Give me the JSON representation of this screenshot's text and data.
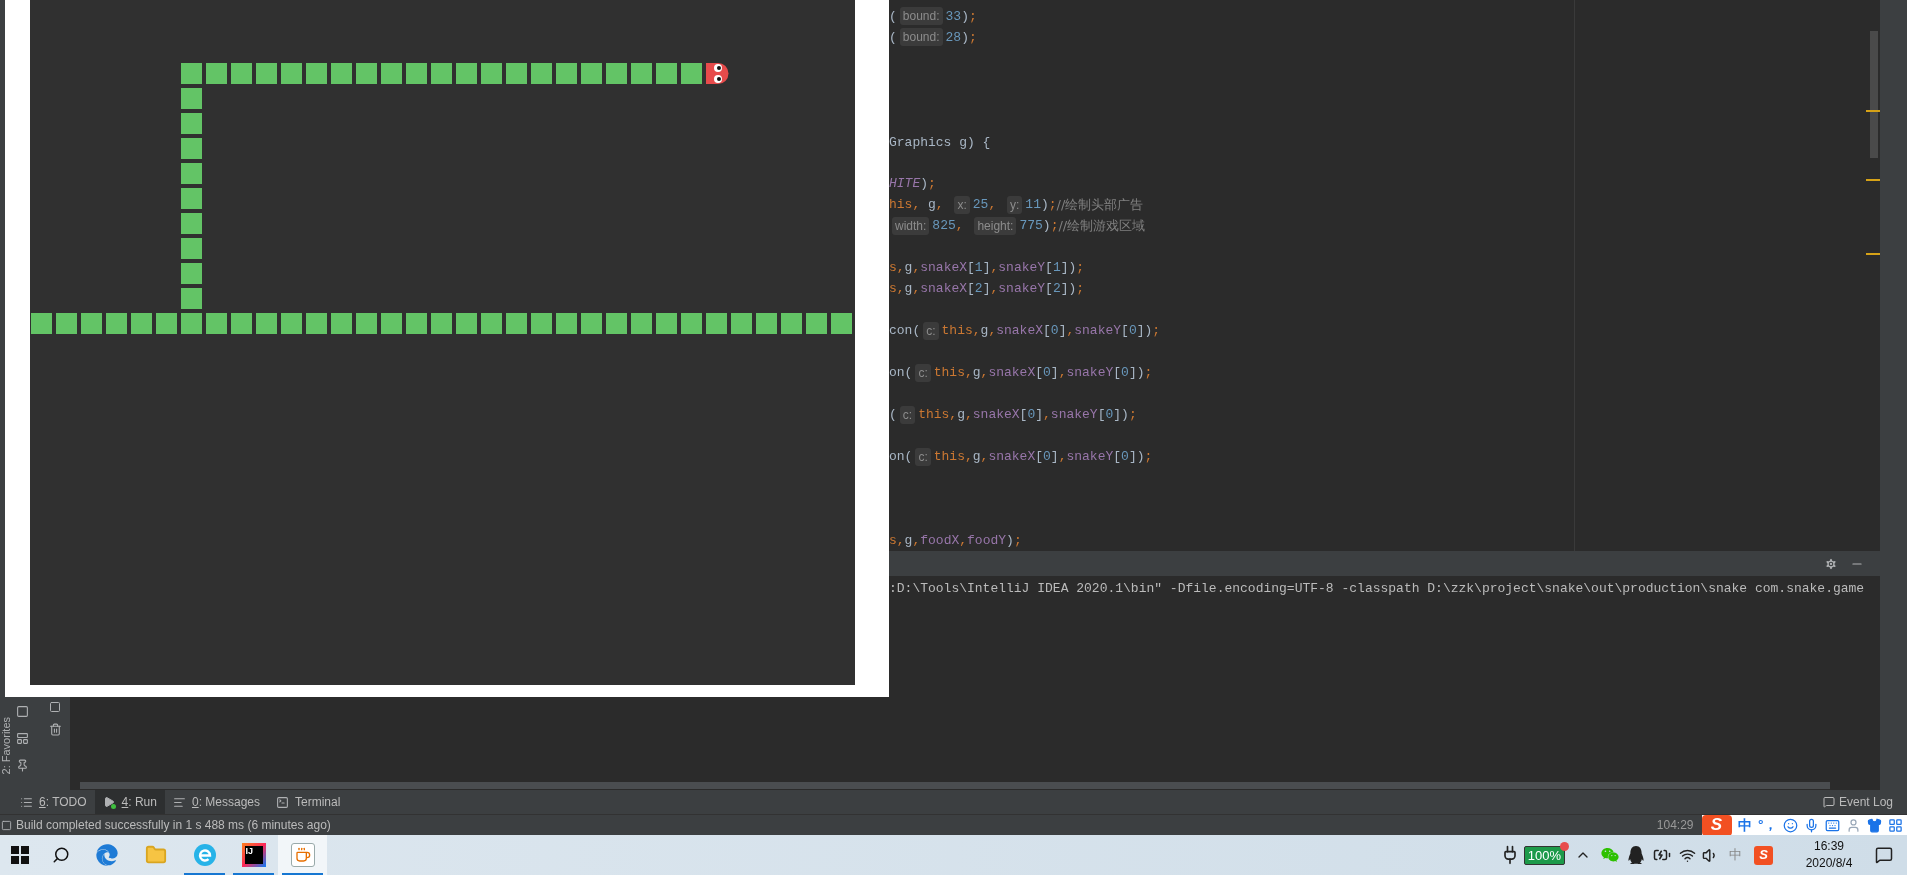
{
  "editor": {
    "lines": [
      {
        "kind": "code",
        "tokens": [
          {
            "kind": "plain",
            "text": "("
          },
          {
            "kind": "hint",
            "text": "bound:"
          },
          {
            "kind": "number",
            "text": "33"
          },
          {
            "kind": "plain",
            "text": ")"
          },
          {
            "kind": "keyword",
            "text": ";"
          }
        ]
      },
      {
        "kind": "code",
        "tokens": [
          {
            "kind": "plain",
            "text": "("
          },
          {
            "kind": "hint",
            "text": "bound:"
          },
          {
            "kind": "number",
            "text": "28"
          },
          {
            "kind": "plain",
            "text": ")"
          },
          {
            "kind": "keyword",
            "text": ";"
          }
        ]
      },
      {
        "kind": "blank"
      },
      {
        "kind": "blank"
      },
      {
        "kind": "blank"
      },
      {
        "kind": "blank"
      },
      {
        "kind": "code",
        "tokens": [
          {
            "kind": "plain",
            "text": "Graphics g) {"
          }
        ]
      },
      {
        "kind": "blank"
      },
      {
        "kind": "code",
        "tokens": [
          {
            "kind": "constant",
            "text": "HITE"
          },
          {
            "kind": "plain",
            "text": ")"
          },
          {
            "kind": "keyword",
            "text": ";"
          }
        ]
      },
      {
        "kind": "code",
        "tokens": [
          {
            "kind": "keyword",
            "text": "his, "
          },
          {
            "kind": "plain",
            "text": "g"
          },
          {
            "kind": "keyword",
            "text": ", "
          },
          {
            "kind": "hint",
            "text": "x:"
          },
          {
            "kind": "number",
            "text": "25"
          },
          {
            "kind": "keyword",
            "text": ", "
          },
          {
            "kind": "hint",
            "text": "y:"
          },
          {
            "kind": "number",
            "text": "11"
          },
          {
            "kind": "plain",
            "text": ")"
          },
          {
            "kind": "keyword",
            "text": ";"
          },
          {
            "kind": "comment",
            "text": "//绘制头部广告"
          }
        ]
      },
      {
        "kind": "code",
        "tokens": [
          {
            "kind": "hint",
            "text": "width:"
          },
          {
            "kind": "number",
            "text": "825"
          },
          {
            "kind": "keyword",
            "text": ", "
          },
          {
            "kind": "hint",
            "text": "height:"
          },
          {
            "kind": "number",
            "text": "775"
          },
          {
            "kind": "plain",
            "text": ")"
          },
          {
            "kind": "keyword",
            "text": ";"
          },
          {
            "kind": "comment",
            "text": "//绘制游戏区域"
          }
        ]
      },
      {
        "kind": "blank"
      },
      {
        "kind": "code",
        "tokens": [
          {
            "kind": "keyword",
            "text": "s,"
          },
          {
            "kind": "plain",
            "text": "g"
          },
          {
            "kind": "keyword",
            "text": ","
          },
          {
            "kind": "field",
            "text": "snakeX"
          },
          {
            "kind": "plain",
            "text": "["
          },
          {
            "kind": "number",
            "text": "1"
          },
          {
            "kind": "plain",
            "text": "]"
          },
          {
            "kind": "keyword",
            "text": ","
          },
          {
            "kind": "field",
            "text": "snakeY"
          },
          {
            "kind": "plain",
            "text": "["
          },
          {
            "kind": "number",
            "text": "1"
          },
          {
            "kind": "plain",
            "text": "])"
          },
          {
            "kind": "keyword",
            "text": ";"
          }
        ]
      },
      {
        "kind": "code",
        "tokens": [
          {
            "kind": "keyword",
            "text": "s,"
          },
          {
            "kind": "plain",
            "text": "g"
          },
          {
            "kind": "keyword",
            "text": ","
          },
          {
            "kind": "field",
            "text": "snakeX"
          },
          {
            "kind": "plain",
            "text": "["
          },
          {
            "kind": "number",
            "text": "2"
          },
          {
            "kind": "plain",
            "text": "]"
          },
          {
            "kind": "keyword",
            "text": ","
          },
          {
            "kind": "field",
            "text": "snakeY"
          },
          {
            "kind": "plain",
            "text": "["
          },
          {
            "kind": "number",
            "text": "2"
          },
          {
            "kind": "plain",
            "text": "])"
          },
          {
            "kind": "keyword",
            "text": ";"
          }
        ]
      },
      {
        "kind": "blank"
      },
      {
        "kind": "code",
        "tokens": [
          {
            "kind": "plain",
            "text": "con("
          },
          {
            "kind": "hint",
            "text": "c:"
          },
          {
            "kind": "keyword",
            "text": "this,"
          },
          {
            "kind": "plain",
            "text": "g"
          },
          {
            "kind": "keyword",
            "text": ","
          },
          {
            "kind": "field",
            "text": "snakeX"
          },
          {
            "kind": "plain",
            "text": "["
          },
          {
            "kind": "number",
            "text": "0"
          },
          {
            "kind": "plain",
            "text": "]"
          },
          {
            "kind": "keyword",
            "text": ","
          },
          {
            "kind": "field",
            "text": "snakeY"
          },
          {
            "kind": "plain",
            "text": "["
          },
          {
            "kind": "number",
            "text": "0"
          },
          {
            "kind": "plain",
            "text": "])"
          },
          {
            "kind": "keyword",
            "text": ";"
          }
        ]
      },
      {
        "kind": "blank"
      },
      {
        "kind": "code",
        "tokens": [
          {
            "kind": "plain",
            "text": "on("
          },
          {
            "kind": "hint",
            "text": "c:"
          },
          {
            "kind": "keyword",
            "text": "this,"
          },
          {
            "kind": "plain",
            "text": "g"
          },
          {
            "kind": "keyword",
            "text": ","
          },
          {
            "kind": "field",
            "text": "snakeX"
          },
          {
            "kind": "plain",
            "text": "["
          },
          {
            "kind": "number",
            "text": "0"
          },
          {
            "kind": "plain",
            "text": "]"
          },
          {
            "kind": "keyword",
            "text": ","
          },
          {
            "kind": "field",
            "text": "snakeY"
          },
          {
            "kind": "plain",
            "text": "["
          },
          {
            "kind": "number",
            "text": "0"
          },
          {
            "kind": "plain",
            "text": "])"
          },
          {
            "kind": "keyword",
            "text": ";"
          }
        ]
      },
      {
        "kind": "blank"
      },
      {
        "kind": "code",
        "tokens": [
          {
            "kind": "plain",
            "text": "("
          },
          {
            "kind": "hint",
            "text": "c:"
          },
          {
            "kind": "keyword",
            "text": "this,"
          },
          {
            "kind": "plain",
            "text": "g"
          },
          {
            "kind": "keyword",
            "text": ","
          },
          {
            "kind": "field",
            "text": "snakeX"
          },
          {
            "kind": "plain",
            "text": "["
          },
          {
            "kind": "number",
            "text": "0"
          },
          {
            "kind": "plain",
            "text": "]"
          },
          {
            "kind": "keyword",
            "text": ","
          },
          {
            "kind": "field",
            "text": "snakeY"
          },
          {
            "kind": "plain",
            "text": "["
          },
          {
            "kind": "number",
            "text": "0"
          },
          {
            "kind": "plain",
            "text": "])"
          },
          {
            "kind": "keyword",
            "text": ";"
          }
        ]
      },
      {
        "kind": "blank"
      },
      {
        "kind": "code",
        "tokens": [
          {
            "kind": "plain",
            "text": "on("
          },
          {
            "kind": "hint",
            "text": "c:"
          },
          {
            "kind": "keyword",
            "text": "this,"
          },
          {
            "kind": "plain",
            "text": "g"
          },
          {
            "kind": "keyword",
            "text": ","
          },
          {
            "kind": "field",
            "text": "snakeX"
          },
          {
            "kind": "plain",
            "text": "["
          },
          {
            "kind": "number",
            "text": "0"
          },
          {
            "kind": "plain",
            "text": "]"
          },
          {
            "kind": "keyword",
            "text": ","
          },
          {
            "kind": "field",
            "text": "snakeY"
          },
          {
            "kind": "plain",
            "text": "["
          },
          {
            "kind": "number",
            "text": "0"
          },
          {
            "kind": "plain",
            "text": "])"
          },
          {
            "kind": "keyword",
            "text": ";"
          }
        ]
      },
      {
        "kind": "blank"
      },
      {
        "kind": "blank"
      },
      {
        "kind": "blank"
      },
      {
        "kind": "code",
        "tokens": [
          {
            "kind": "keyword",
            "text": "s,"
          },
          {
            "kind": "plain",
            "text": "g"
          },
          {
            "kind": "keyword",
            "text": ","
          },
          {
            "kind": "field",
            "text": "foodX"
          },
          {
            "kind": "keyword",
            "text": ","
          },
          {
            "kind": "field",
            "text": "foodY"
          },
          {
            "kind": "plain",
            "text": ")"
          },
          {
            "kind": "keyword",
            "text": ";"
          }
        ]
      }
    ]
  },
  "run_panel": {
    "output": ":D:\\Tools\\IntelliJ IDEA 2020.1\\bin\" -Dfile.encoding=UTF-8 -classpath D:\\zzk\\project\\snake\\out\\production\\snake com.snake.game"
  },
  "left_strip": {
    "label": "2: Favorites"
  },
  "tool_tabs": [
    {
      "mnemonic": "6",
      "label": ": TODO",
      "kind": "list",
      "selected": false
    },
    {
      "mnemonic": "4",
      "label": ": Run",
      "kind": "run",
      "selected": true
    },
    {
      "mnemonic": "0",
      "label": ": Messages",
      "kind": "messages",
      "selected": false
    },
    {
      "label": "Terminal",
      "kind": "terminal",
      "selected": false
    }
  ],
  "event_log": "Event Log",
  "status_bar": {
    "message": "Build completed successfully in 1 s 488 ms (6 minutes ago)",
    "position": "104:29",
    "ime_logo": "S",
    "ime_mode": "中",
    "ime_punct": "°，"
  },
  "taskbar": {
    "apps": [
      {
        "kind": "edge",
        "running": false,
        "selected": false
      },
      {
        "kind": "explorer",
        "running": false,
        "selected": false
      },
      {
        "kind": "browser",
        "running": true,
        "selected": false
      },
      {
        "kind": "ide",
        "badge": "IJ",
        "running": true,
        "selected": false
      },
      {
        "kind": "java",
        "running": true,
        "selected": true
      }
    ],
    "battery": "100%",
    "tray_ime": "中",
    "tray_ime_logo": "S",
    "time": "16:39",
    "date": "2020/8/4"
  }
}
